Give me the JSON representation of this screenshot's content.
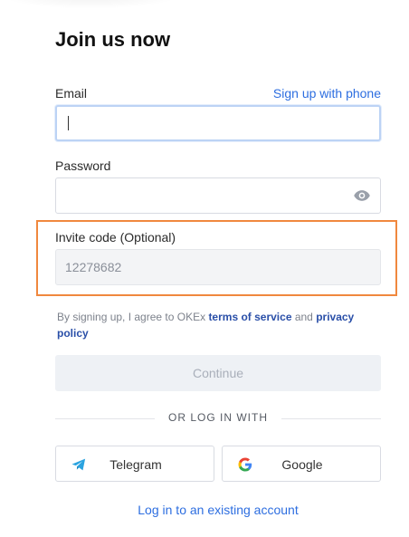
{
  "header": {
    "title": "Join us now"
  },
  "email": {
    "label": "Email",
    "alt_link": "Sign up with phone",
    "value": ""
  },
  "password": {
    "label": "Password",
    "value": ""
  },
  "invite": {
    "label": "Invite code (Optional)",
    "value": "12278682"
  },
  "terms": {
    "prefix": "By signing up, I agree to OKEx ",
    "tos": "terms of service",
    "and": " and ",
    "privacy": "privacy policy"
  },
  "actions": {
    "continue": "Continue"
  },
  "divider": {
    "text": "OR LOG IN WITH"
  },
  "social": [
    {
      "label": "Telegram",
      "icon": "telegram-icon"
    },
    {
      "label": "Google",
      "icon": "google-icon"
    }
  ],
  "footer": {
    "login_link": "Log in to an existing account"
  },
  "colors": {
    "link": "#2d6ee0",
    "highlight": "#f0883e",
    "dark_link": "#2a4fa8"
  }
}
